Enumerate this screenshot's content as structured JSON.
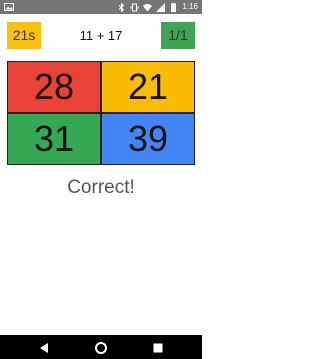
{
  "status_bar": {
    "time": "1:16",
    "icons": [
      "image-icon",
      "bluetooth-icon",
      "vibrate-icon",
      "wifi-icon",
      "signal-icon",
      "battery-icon"
    ]
  },
  "game": {
    "timer": "21s",
    "question": "11 + 17",
    "score": "1/1",
    "answers": [
      "28",
      "21",
      "31",
      "39"
    ],
    "result": "Correct!"
  },
  "colors": {
    "timer_bg": "#ffc107",
    "score_bg": "#3da450",
    "answer_bg": [
      "#ea4335",
      "#fbbc05",
      "#34a853",
      "#4285f4"
    ]
  },
  "nav": {
    "icons": [
      "back-icon",
      "home-icon",
      "recent-apps-icon"
    ]
  }
}
